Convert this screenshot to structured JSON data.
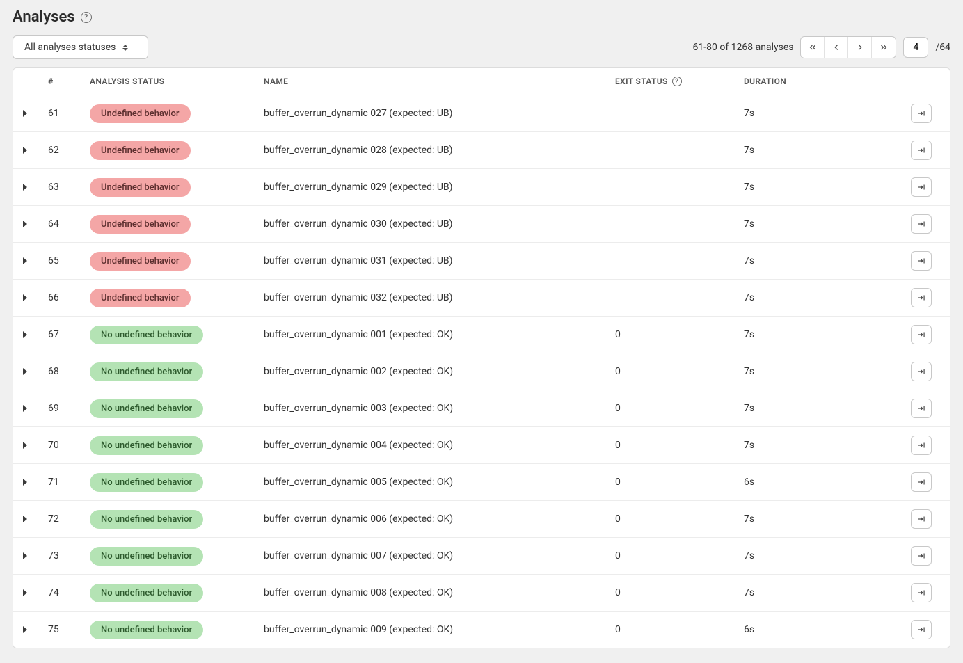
{
  "page": {
    "title": "Analyses",
    "filter_label": "All analyses statuses",
    "range_text": "61-80 of 1268 analyses",
    "current_page": "4",
    "total_pages": "/64"
  },
  "columns": {
    "num": "#",
    "status": "ANALYSIS STATUS",
    "name": "NAME",
    "exit": "EXIT STATUS",
    "duration": "DURATION"
  },
  "status_labels": {
    "ub": "Undefined behavior",
    "noub": "No undefined behavior"
  },
  "rows": [
    {
      "num": "61",
      "status": "ub",
      "name": "buffer_overrun_dynamic 027 (expected: UB)",
      "exit": "",
      "duration": "7s"
    },
    {
      "num": "62",
      "status": "ub",
      "name": "buffer_overrun_dynamic 028 (expected: UB)",
      "exit": "",
      "duration": "7s"
    },
    {
      "num": "63",
      "status": "ub",
      "name": "buffer_overrun_dynamic 029 (expected: UB)",
      "exit": "",
      "duration": "7s"
    },
    {
      "num": "64",
      "status": "ub",
      "name": "buffer_overrun_dynamic 030 (expected: UB)",
      "exit": "",
      "duration": "7s"
    },
    {
      "num": "65",
      "status": "ub",
      "name": "buffer_overrun_dynamic 031 (expected: UB)",
      "exit": "",
      "duration": "7s"
    },
    {
      "num": "66",
      "status": "ub",
      "name": "buffer_overrun_dynamic 032 (expected: UB)",
      "exit": "",
      "duration": "7s"
    },
    {
      "num": "67",
      "status": "noub",
      "name": "buffer_overrun_dynamic 001 (expected: OK)",
      "exit": "0",
      "duration": "7s"
    },
    {
      "num": "68",
      "status": "noub",
      "name": "buffer_overrun_dynamic 002 (expected: OK)",
      "exit": "0",
      "duration": "7s"
    },
    {
      "num": "69",
      "status": "noub",
      "name": "buffer_overrun_dynamic 003 (expected: OK)",
      "exit": "0",
      "duration": "7s"
    },
    {
      "num": "70",
      "status": "noub",
      "name": "buffer_overrun_dynamic 004 (expected: OK)",
      "exit": "0",
      "duration": "7s"
    },
    {
      "num": "71",
      "status": "noub",
      "name": "buffer_overrun_dynamic 005 (expected: OK)",
      "exit": "0",
      "duration": "6s"
    },
    {
      "num": "72",
      "status": "noub",
      "name": "buffer_overrun_dynamic 006 (expected: OK)",
      "exit": "0",
      "duration": "7s"
    },
    {
      "num": "73",
      "status": "noub",
      "name": "buffer_overrun_dynamic 007 (expected: OK)",
      "exit": "0",
      "duration": "7s"
    },
    {
      "num": "74",
      "status": "noub",
      "name": "buffer_overrun_dynamic 008 (expected: OK)",
      "exit": "0",
      "duration": "7s"
    },
    {
      "num": "75",
      "status": "noub",
      "name": "buffer_overrun_dynamic 009 (expected: OK)",
      "exit": "0",
      "duration": "6s"
    }
  ]
}
